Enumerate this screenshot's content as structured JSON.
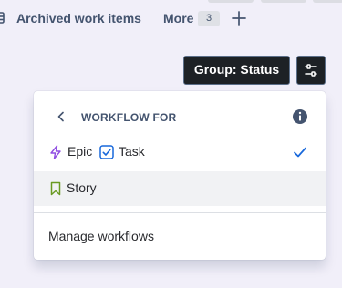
{
  "tabbar": {
    "archived_label": "Archived work items",
    "more_label": "More",
    "more_count": "3",
    "add_icon": "plus-icon",
    "archive_icon": "archive-icon"
  },
  "toolbar": {
    "group_label": "Group: Status",
    "settings_icon": "sliders-icon"
  },
  "dropdown": {
    "title": "WORKFLOW FOR",
    "back_icon": "chevron-left-icon",
    "info_icon": "info-icon",
    "selected_workflow": {
      "items": [
        {
          "label": "Epic",
          "icon": "epic-lightning-icon"
        },
        {
          "label": "Task",
          "icon": "task-checkbox-icon"
        }
      ],
      "selected_icon": "checkmark-icon"
    },
    "story_workflow": {
      "items": [
        {
          "label": "Story",
          "icon": "story-bookmark-icon"
        }
      ]
    },
    "manage_label": "Manage workflows"
  },
  "colors": {
    "background": "#f1eff9",
    "button_dark": "#1d2125",
    "epic": "#904ee2",
    "task": "#1868db",
    "story": "#6a9a23",
    "check": "#1868db",
    "hover_row": "#f1f2f4"
  }
}
